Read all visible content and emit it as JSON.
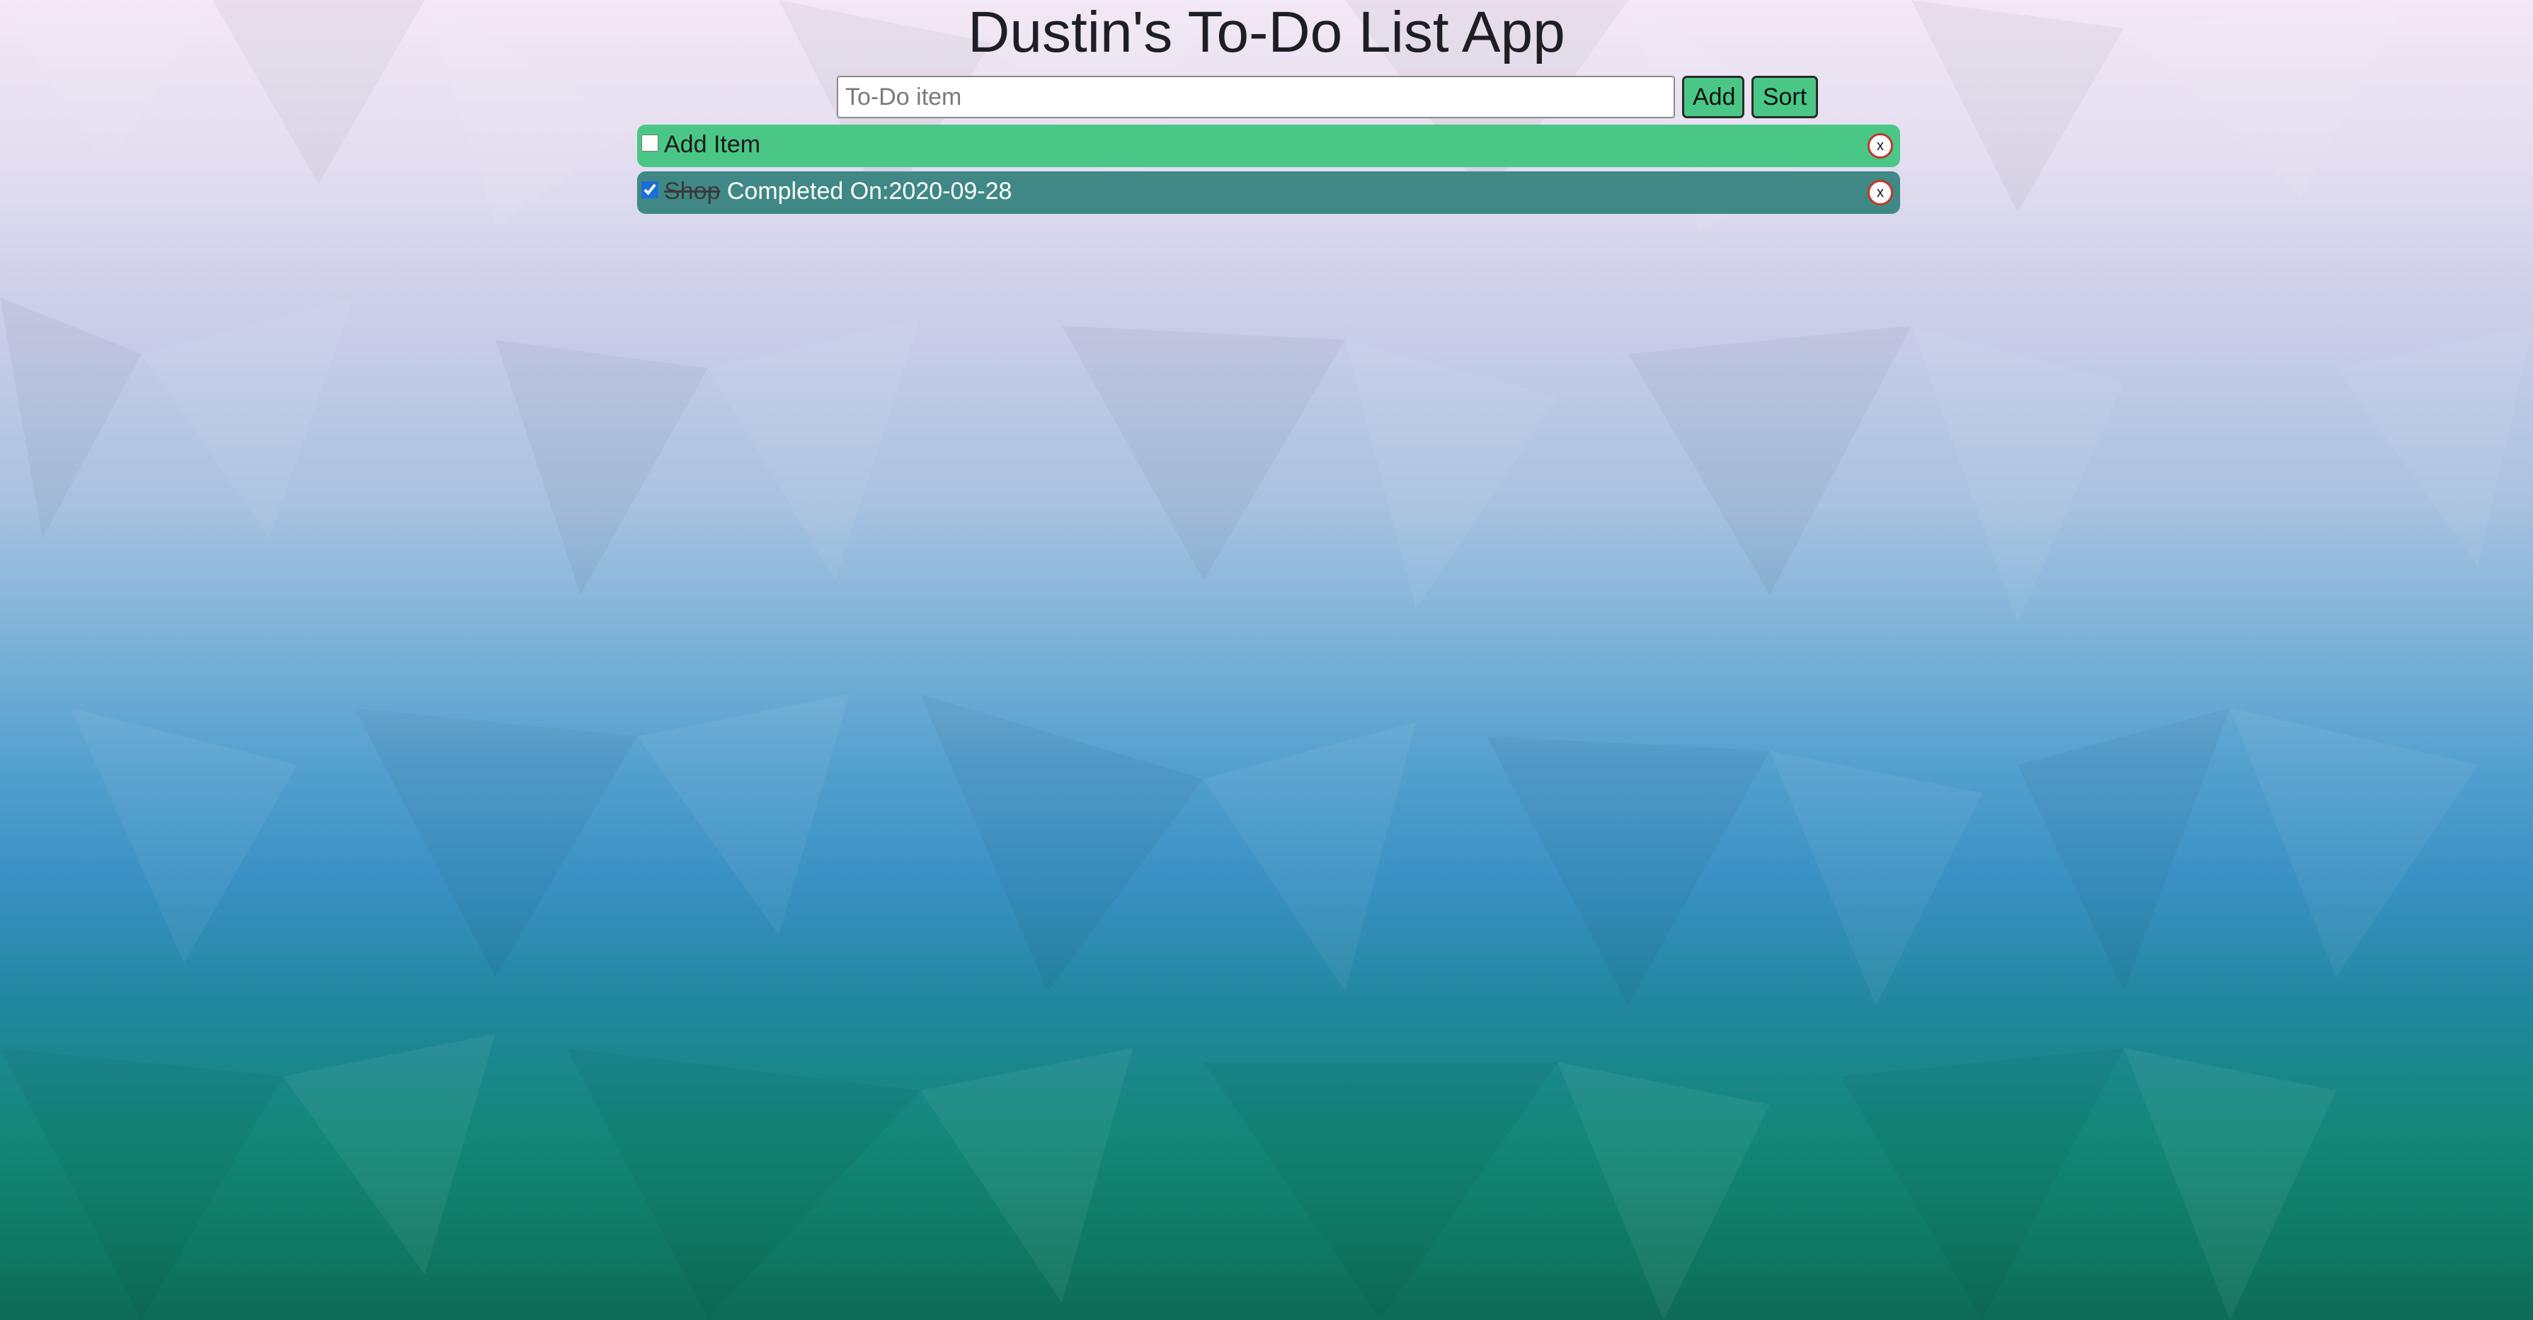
{
  "app": {
    "title": "Dustin's To-Do List App"
  },
  "form": {
    "input_value": "",
    "input_placeholder": "To-Do item",
    "add_label": "Add",
    "sort_label": "Sort"
  },
  "items": [
    {
      "text": "Add Item",
      "checked": false,
      "completed_text": "",
      "remove_label": "x"
    },
    {
      "text": "Shop",
      "checked": true,
      "completed_text": " Completed On:2020-09-28",
      "remove_label": "x"
    }
  ],
  "colors": {
    "pending_item_bg": "#4ac687",
    "completed_item_bg": "#3f8885",
    "button_bg": "#4ac787",
    "remove_border": "#c0392b"
  }
}
